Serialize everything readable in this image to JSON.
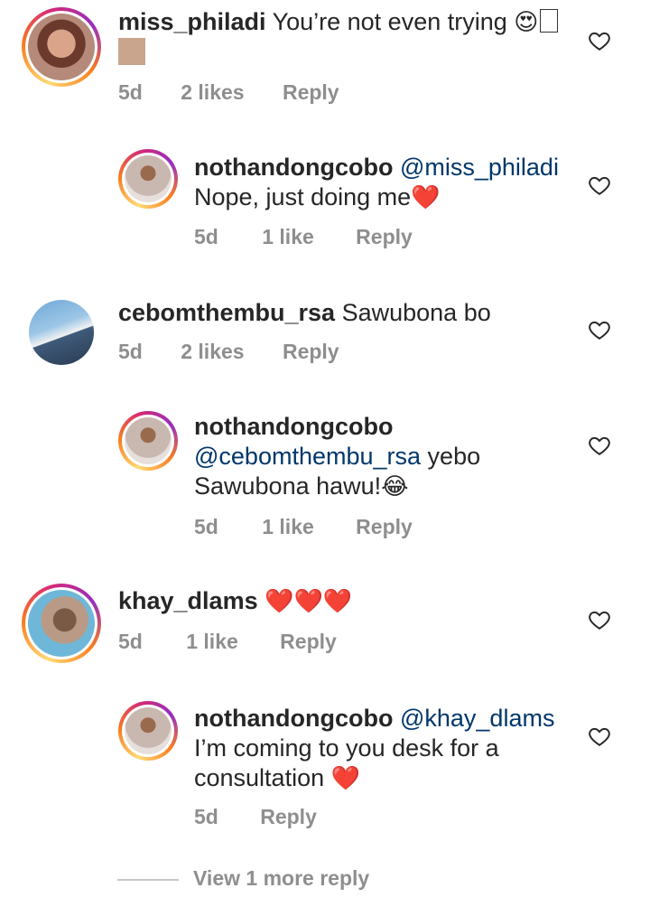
{
  "comments": [
    {
      "username": "miss_philadi",
      "text": "You’re not even trying",
      "emoji": "😍",
      "time": "5d",
      "likes": "2 likes",
      "reply": "Reply"
    },
    {
      "username": "nothandongcobo",
      "mention": "@miss_philadi",
      "text": "Nope, just doing me",
      "emoji": "❤️",
      "time": "5d",
      "likes": "1 like",
      "reply": "Reply"
    },
    {
      "username": "cebomthembu_rsa",
      "text": "Sawubona bo",
      "time": "5d",
      "likes": "2 likes",
      "reply": "Reply"
    },
    {
      "username": "nothandongcobo",
      "mention": "@cebomthembu_rsa",
      "text": "yebo",
      "text2": "Sawubona hawu!",
      "emoji": "😂",
      "time": "5d",
      "likes": "1 like",
      "reply": "Reply"
    },
    {
      "username": "khay_dlams",
      "emoji": "❤️❤️❤️",
      "time": "5d",
      "likes": "1 like",
      "reply": "Reply"
    },
    {
      "username": "nothandongcobo",
      "mention": "@khay_dlams",
      "text": "I’m coming to you desk for a",
      "text2": "consultation",
      "emoji": "❤️",
      "time": "5d",
      "reply": "Reply"
    }
  ],
  "view_more_label": "View 1 more reply",
  "icons": {
    "like": "heart-outline-icon"
  },
  "colors": {
    "text": "#262626",
    "secondary": "#8e8e8e",
    "mention": "#00376b",
    "heart_red": "#e01b24"
  }
}
